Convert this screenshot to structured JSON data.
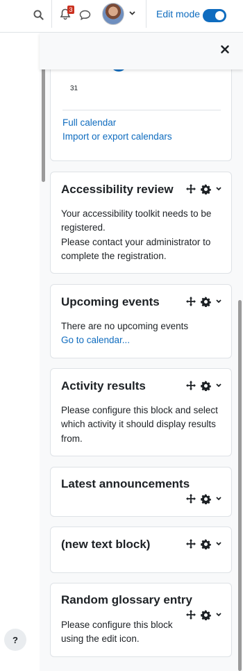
{
  "navbar": {
    "notification_count": "3",
    "edit_mode_label": "Edit mode",
    "edit_mode_on": true
  },
  "calendar_block": {
    "day_number": "31",
    "full_calendar_link": "Full calendar",
    "import_export_link": "Import or export calendars"
  },
  "blocks": [
    {
      "title": "Accessibility review",
      "lines": [
        "Your accessibility toolkit needs to be",
        "registered.",
        "Please contact your administrator to",
        "complete the registration."
      ]
    },
    {
      "title": "Upcoming events",
      "text": "There are no upcoming events",
      "link": "Go to calendar..."
    },
    {
      "title": "Activity results",
      "lines": [
        "Please configure this block and select",
        "which activity it should display results",
        "from."
      ]
    },
    {
      "title": "Latest announcements"
    },
    {
      "title": "(new text block)"
    },
    {
      "title": "Random glossary entry",
      "lines": [
        "Please configure this block",
        "using the edit icon."
      ]
    }
  ],
  "help_button_label": "?",
  "colors": {
    "accent": "#0f6cbf",
    "badge": "#ca3120",
    "drawer_bg": "#f8f9fa"
  }
}
